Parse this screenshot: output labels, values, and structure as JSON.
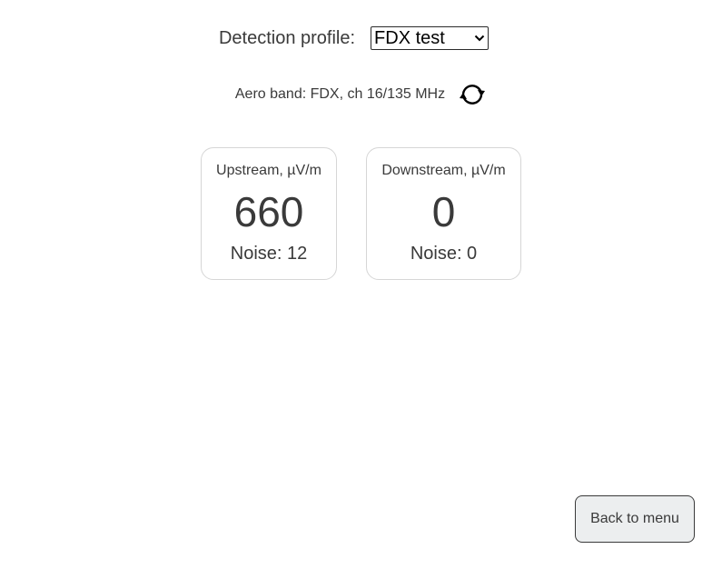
{
  "detection_profile": {
    "label": "Detection profile:",
    "selected": "FDX test"
  },
  "band": {
    "text": "Aero band: FDX, ch 16/135 MHz",
    "refresh_icon": "refresh-icon"
  },
  "cards": {
    "upstream": {
      "title": "Upstream, µV/m",
      "value": "660",
      "noise": "Noise: 12"
    },
    "downstream": {
      "title": "Downstream, µV/m",
      "value": "0",
      "noise": "Noise: 0"
    }
  },
  "footer": {
    "back_label": "Back to menu"
  }
}
